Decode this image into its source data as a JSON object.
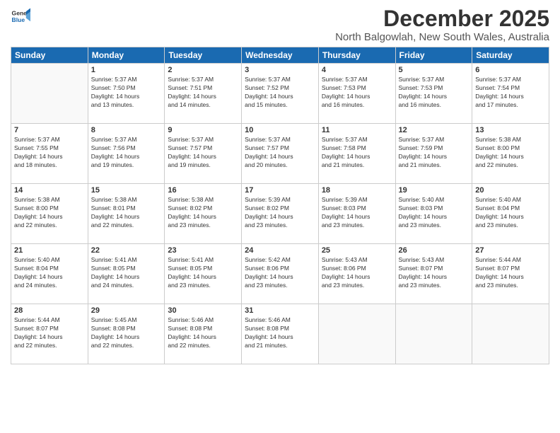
{
  "logo": {
    "line1": "General",
    "line2": "Blue"
  },
  "title": "December 2025",
  "location": "North Balgowlah, New South Wales, Australia",
  "headers": [
    "Sunday",
    "Monday",
    "Tuesday",
    "Wednesday",
    "Thursday",
    "Friday",
    "Saturday"
  ],
  "weeks": [
    [
      {
        "day": "",
        "info": ""
      },
      {
        "day": "1",
        "info": "Sunrise: 5:37 AM\nSunset: 7:50 PM\nDaylight: 14 hours\nand 13 minutes."
      },
      {
        "day": "2",
        "info": "Sunrise: 5:37 AM\nSunset: 7:51 PM\nDaylight: 14 hours\nand 14 minutes."
      },
      {
        "day": "3",
        "info": "Sunrise: 5:37 AM\nSunset: 7:52 PM\nDaylight: 14 hours\nand 15 minutes."
      },
      {
        "day": "4",
        "info": "Sunrise: 5:37 AM\nSunset: 7:53 PM\nDaylight: 14 hours\nand 16 minutes."
      },
      {
        "day": "5",
        "info": "Sunrise: 5:37 AM\nSunset: 7:53 PM\nDaylight: 14 hours\nand 16 minutes."
      },
      {
        "day": "6",
        "info": "Sunrise: 5:37 AM\nSunset: 7:54 PM\nDaylight: 14 hours\nand 17 minutes."
      }
    ],
    [
      {
        "day": "7",
        "info": "Sunrise: 5:37 AM\nSunset: 7:55 PM\nDaylight: 14 hours\nand 18 minutes."
      },
      {
        "day": "8",
        "info": "Sunrise: 5:37 AM\nSunset: 7:56 PM\nDaylight: 14 hours\nand 19 minutes."
      },
      {
        "day": "9",
        "info": "Sunrise: 5:37 AM\nSunset: 7:57 PM\nDaylight: 14 hours\nand 19 minutes."
      },
      {
        "day": "10",
        "info": "Sunrise: 5:37 AM\nSunset: 7:57 PM\nDaylight: 14 hours\nand 20 minutes."
      },
      {
        "day": "11",
        "info": "Sunrise: 5:37 AM\nSunset: 7:58 PM\nDaylight: 14 hours\nand 21 minutes."
      },
      {
        "day": "12",
        "info": "Sunrise: 5:37 AM\nSunset: 7:59 PM\nDaylight: 14 hours\nand 21 minutes."
      },
      {
        "day": "13",
        "info": "Sunrise: 5:38 AM\nSunset: 8:00 PM\nDaylight: 14 hours\nand 22 minutes."
      }
    ],
    [
      {
        "day": "14",
        "info": "Sunrise: 5:38 AM\nSunset: 8:00 PM\nDaylight: 14 hours\nand 22 minutes."
      },
      {
        "day": "15",
        "info": "Sunrise: 5:38 AM\nSunset: 8:01 PM\nDaylight: 14 hours\nand 22 minutes."
      },
      {
        "day": "16",
        "info": "Sunrise: 5:38 AM\nSunset: 8:02 PM\nDaylight: 14 hours\nand 23 minutes."
      },
      {
        "day": "17",
        "info": "Sunrise: 5:39 AM\nSunset: 8:02 PM\nDaylight: 14 hours\nand 23 minutes."
      },
      {
        "day": "18",
        "info": "Sunrise: 5:39 AM\nSunset: 8:03 PM\nDaylight: 14 hours\nand 23 minutes."
      },
      {
        "day": "19",
        "info": "Sunrise: 5:40 AM\nSunset: 8:03 PM\nDaylight: 14 hours\nand 23 minutes."
      },
      {
        "day": "20",
        "info": "Sunrise: 5:40 AM\nSunset: 8:04 PM\nDaylight: 14 hours\nand 23 minutes."
      }
    ],
    [
      {
        "day": "21",
        "info": "Sunrise: 5:40 AM\nSunset: 8:04 PM\nDaylight: 14 hours\nand 24 minutes."
      },
      {
        "day": "22",
        "info": "Sunrise: 5:41 AM\nSunset: 8:05 PM\nDaylight: 14 hours\nand 24 minutes."
      },
      {
        "day": "23",
        "info": "Sunrise: 5:41 AM\nSunset: 8:05 PM\nDaylight: 14 hours\nand 23 minutes."
      },
      {
        "day": "24",
        "info": "Sunrise: 5:42 AM\nSunset: 8:06 PM\nDaylight: 14 hours\nand 23 minutes."
      },
      {
        "day": "25",
        "info": "Sunrise: 5:43 AM\nSunset: 8:06 PM\nDaylight: 14 hours\nand 23 minutes."
      },
      {
        "day": "26",
        "info": "Sunrise: 5:43 AM\nSunset: 8:07 PM\nDaylight: 14 hours\nand 23 minutes."
      },
      {
        "day": "27",
        "info": "Sunrise: 5:44 AM\nSunset: 8:07 PM\nDaylight: 14 hours\nand 23 minutes."
      }
    ],
    [
      {
        "day": "28",
        "info": "Sunrise: 5:44 AM\nSunset: 8:07 PM\nDaylight: 14 hours\nand 22 minutes."
      },
      {
        "day": "29",
        "info": "Sunrise: 5:45 AM\nSunset: 8:08 PM\nDaylight: 14 hours\nand 22 minutes."
      },
      {
        "day": "30",
        "info": "Sunrise: 5:46 AM\nSunset: 8:08 PM\nDaylight: 14 hours\nand 22 minutes."
      },
      {
        "day": "31",
        "info": "Sunrise: 5:46 AM\nSunset: 8:08 PM\nDaylight: 14 hours\nand 21 minutes."
      },
      {
        "day": "",
        "info": ""
      },
      {
        "day": "",
        "info": ""
      },
      {
        "day": "",
        "info": ""
      }
    ]
  ]
}
